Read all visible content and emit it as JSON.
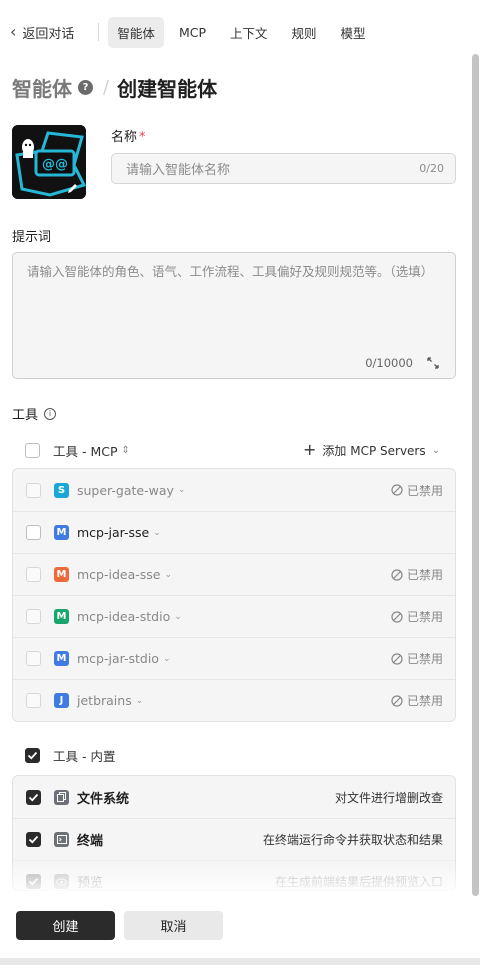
{
  "nav": {
    "back_label": "返回对话",
    "tabs": [
      {
        "label": "智能体",
        "active": true
      },
      {
        "label": "MCP",
        "active": false
      },
      {
        "label": "上下文",
        "active": false
      },
      {
        "label": "规则",
        "active": false
      },
      {
        "label": "模型",
        "active": false
      }
    ]
  },
  "heading": {
    "crumb": "智能体",
    "title": "创建智能体",
    "separator": "/"
  },
  "form": {
    "name_label": "名称",
    "name_required_mark": "*",
    "name_placeholder": "请输入智能体名称",
    "name_counter": "0/20",
    "prompt_label": "提示词",
    "prompt_placeholder": "请输入智能体的角色、语气、工作流程、工具偏好及规则规范等。（选填）",
    "prompt_counter": "0/10000"
  },
  "tools": {
    "label": "工具",
    "mcp_header": "工具 - MCP",
    "add_mcp_label": "添加 MCP Servers",
    "disabled_label": "已禁用",
    "mcp_servers": [
      {
        "name": "super-gate-way",
        "icon_letter": "S",
        "icon_color": "#1aa7d8",
        "disabled": true
      },
      {
        "name": "mcp-jar-sse",
        "icon_letter": "M",
        "icon_color": "#3f7be0",
        "disabled": false
      },
      {
        "name": "mcp-idea-sse",
        "icon_letter": "M",
        "icon_color": "#ef6a3a",
        "disabled": true
      },
      {
        "name": "mcp-idea-stdio",
        "icon_letter": "M",
        "icon_color": "#16a66b",
        "disabled": true
      },
      {
        "name": "mcp-jar-stdio",
        "icon_letter": "M",
        "icon_color": "#3f7be0",
        "disabled": true
      },
      {
        "name": "jetbrains",
        "icon_letter": "J",
        "icon_color": "#3f7be0",
        "disabled": true
      }
    ],
    "builtin_header": "工具 - 内置",
    "builtin": [
      {
        "name": "文件系统",
        "desc": "对文件进行增删改查",
        "icon": "file-icon",
        "checked": true
      },
      {
        "name": "终端",
        "desc": "在终端运行命令并获取状态和结果",
        "icon": "terminal-icon",
        "checked": true
      },
      {
        "name": "预览",
        "desc": "在生成前端结果后提供预览入口",
        "icon": "eye-icon",
        "checked": true
      }
    ]
  },
  "footer": {
    "create_label": "创建",
    "cancel_label": "取消"
  }
}
